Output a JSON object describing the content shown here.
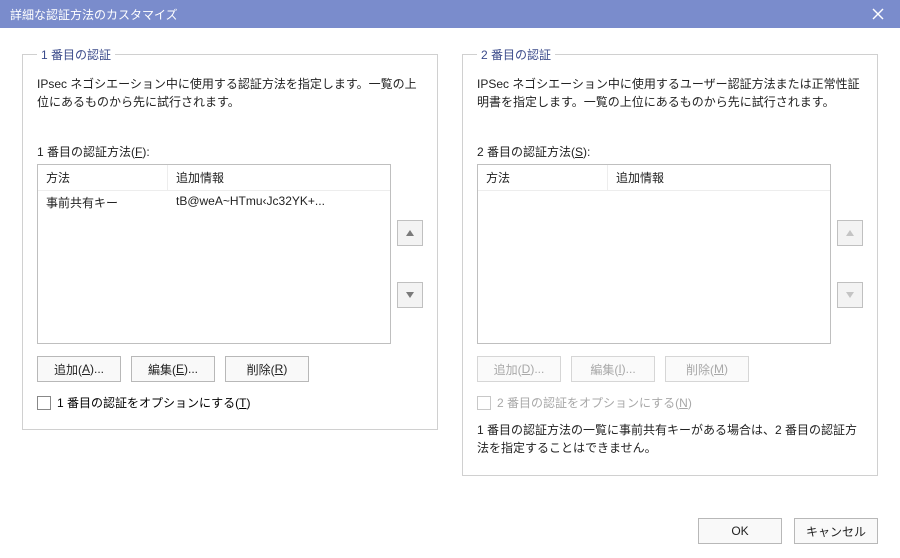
{
  "title": "詳細な認証方法のカスタマイズ",
  "first": {
    "legend": "1 番目の認証",
    "desc": "IPsec ネゴシエーション中に使用する認証方法を指定します。一覧の上位にあるものから先に試行されます。",
    "sublabel_pre": "1 番目の認証方法(",
    "sublabel_key": "F",
    "sublabel_post": "):",
    "col_method": "方法",
    "col_info": "追加情報",
    "row0_method": "事前共有キー",
    "row0_info": "tB@weA~HTmu‹Jc32YK+...",
    "add_pre": "追加(",
    "add_key": "A",
    "add_post": ")...",
    "edit_pre": "編集(",
    "edit_key": "E",
    "edit_post": ")...",
    "del_pre": "削除(",
    "del_key": "R",
    "del_post": ")",
    "opt_pre": "1 番目の認証をオプションにする(",
    "opt_key": "T",
    "opt_post": ")"
  },
  "second": {
    "legend": "2 番目の認証",
    "desc": "IPSec ネゴシエーション中に使用するユーザー認証方法または正常性証明書を指定します。一覧の上位にあるものから先に試行されます。",
    "sublabel_pre": "2 番目の認証方法(",
    "sublabel_key": "S",
    "sublabel_post": "):",
    "col_method": "方法",
    "col_info": "追加情報",
    "add_pre": "追加(",
    "add_key": "D",
    "add_post": ")...",
    "edit_pre": "編集(",
    "edit_key": "I",
    "edit_post": ")...",
    "del_pre": "削除(",
    "del_key": "M",
    "del_post": ")",
    "opt_pre": "2 番目の認証をオプションにする(",
    "opt_key": "N",
    "opt_post": ")",
    "note": "1 番目の認証方法の一覧に事前共有キーがある場合は、2 番目の認証方法を指定することはできません。"
  },
  "ok": "OK",
  "cancel": "キャンセル"
}
